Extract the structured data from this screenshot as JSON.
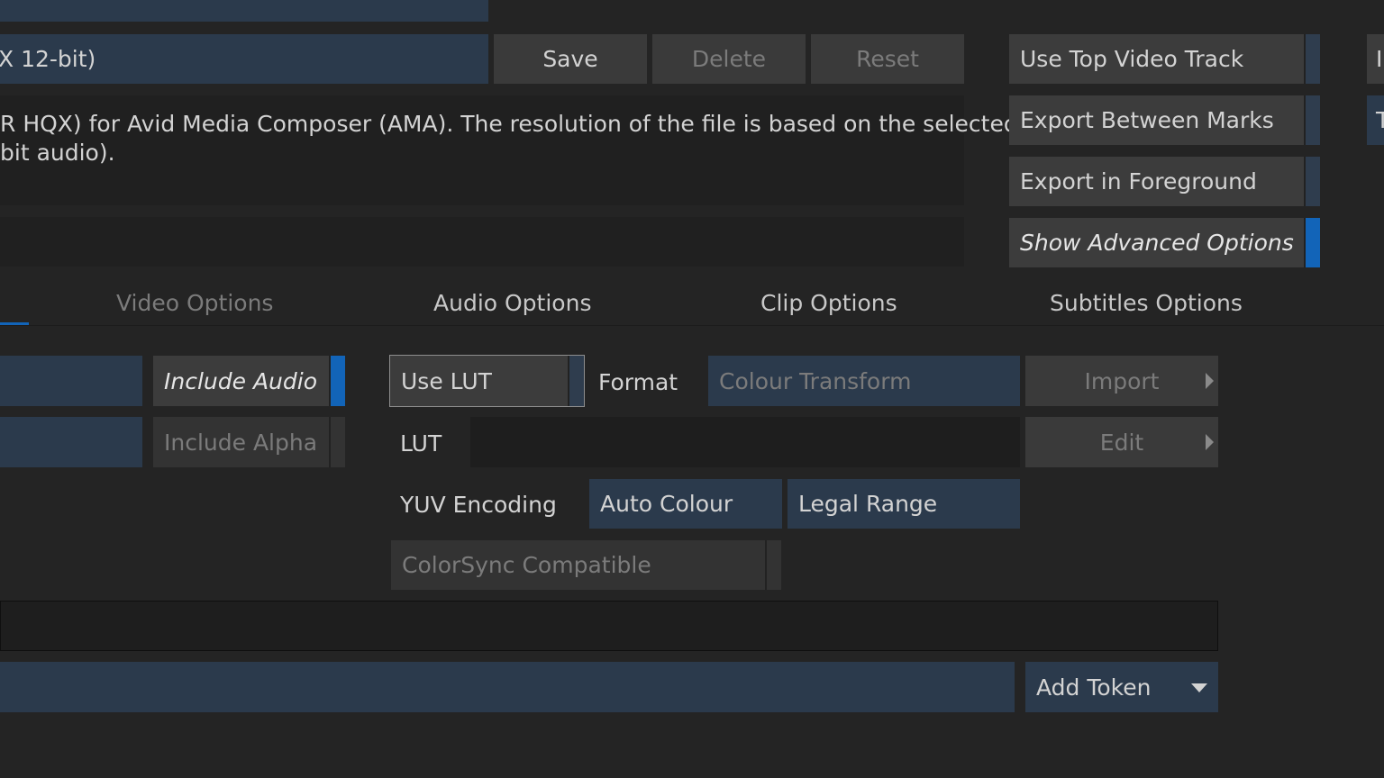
{
  "preset": {
    "name_value": "X 12-bit)",
    "save_label": "Save",
    "delete_label": "Delete",
    "reset_label": "Reset",
    "description_line1": "R HQX) for Avid Media Composer (AMA).  The resolution of the file is based on the selected",
    "description_line2": "bit audio)."
  },
  "right_options": {
    "use_top_video_track": "Use Top Video Track",
    "export_between_marks": "Export Between Marks",
    "export_in_foreground": "Export in Foreground",
    "show_advanced_options": "Show Advanced Options",
    "edge_label_1": "I",
    "edge_label_2": "T"
  },
  "tabs": [
    {
      "label": "Video Options"
    },
    {
      "label": "Audio Options"
    },
    {
      "label": "Clip Options"
    },
    {
      "label": "Subtitles Options"
    }
  ],
  "video": {
    "include_audio": "Include Audio",
    "include_alpha": "Include Alpha",
    "use_lut": "Use LUT",
    "format_label": "Format",
    "format_value": "Colour Transform",
    "import_label": "Import",
    "lut_label": "LUT",
    "lut_value": "",
    "edit_label": "Edit",
    "yuv_label": "YUV Encoding",
    "yuv_value": "Auto Colour",
    "range_value": "Legal Range",
    "colorsync": "ColorSync Compatible"
  },
  "filename": {
    "value": "",
    "add_token_label": "Add Token"
  },
  "colors": {
    "background": "#242424",
    "field": "#2b3a4c",
    "button": "#3a3a3a",
    "accent": "#1264b8"
  }
}
